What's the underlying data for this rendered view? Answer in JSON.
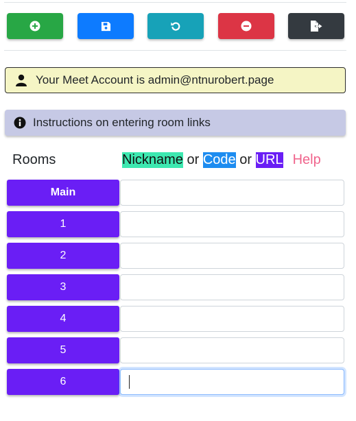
{
  "toolbar": {
    "buttons": [
      {
        "icon": "plus-circle-icon",
        "color": "#28a745"
      },
      {
        "icon": "save-icon",
        "color": "#0d7bff"
      },
      {
        "icon": "undo-icon",
        "color": "#17a2b8"
      },
      {
        "icon": "minus-circle-icon",
        "color": "#dc3545"
      },
      {
        "icon": "export-file-icon",
        "color": "#343a40"
      }
    ]
  },
  "account": {
    "icon": "user-icon",
    "text": "Your Meet Account is admin@ntnurobert.page"
  },
  "instructions": {
    "icon": "info-circle-icon",
    "text": "Instructions on entering room links"
  },
  "rooms": {
    "heading": "Rooms",
    "legend": {
      "nickname": "Nickname",
      "or1": " or ",
      "code": "Code",
      "or2": " or ",
      "url": "URL",
      "help": "Help"
    },
    "items": [
      {
        "label": "Main",
        "value": ""
      },
      {
        "label": "1",
        "value": ""
      },
      {
        "label": "2",
        "value": ""
      },
      {
        "label": "3",
        "value": ""
      },
      {
        "label": "4",
        "value": ""
      },
      {
        "label": "5",
        "value": ""
      },
      {
        "label": "6",
        "value": ""
      }
    ]
  },
  "colors": {
    "room_label": "#6a1ef5",
    "account_bg": "#f5f5c5",
    "instructions_bg": "#c6c9e5"
  }
}
